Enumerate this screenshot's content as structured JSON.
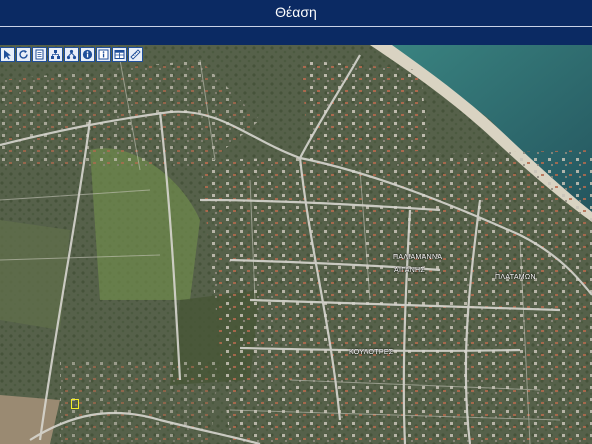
{
  "window": {
    "title": "Θέαση"
  },
  "toolbar": {
    "tools": [
      {
        "icon": "select-arrow-icon"
      },
      {
        "icon": "refresh-icon"
      },
      {
        "icon": "document-icon"
      },
      {
        "icon": "network-icon"
      },
      {
        "icon": "hierarchy-icon"
      },
      {
        "icon": "info-icon"
      },
      {
        "icon": "info-icon"
      },
      {
        "icon": "table-icon"
      },
      {
        "icon": "measure-icon"
      }
    ]
  },
  "map": {
    "labels": {
      "palaiamanna": "ΠΑΛΙΑΜΑΝΝΑ",
      "aiganis": "ΑΙΓΑΝΗΣ",
      "platamon": "ΠΛΑΤΑΜΩΝ",
      "koulotres": "ΚΟΥΛΟΤΡΕΣ"
    },
    "colors": {
      "land": "#56614a",
      "sea": "#2e6f75",
      "beach": "#d9d3c2",
      "road": "#d7d6cf",
      "marker": "#f4ec2a"
    }
  }
}
